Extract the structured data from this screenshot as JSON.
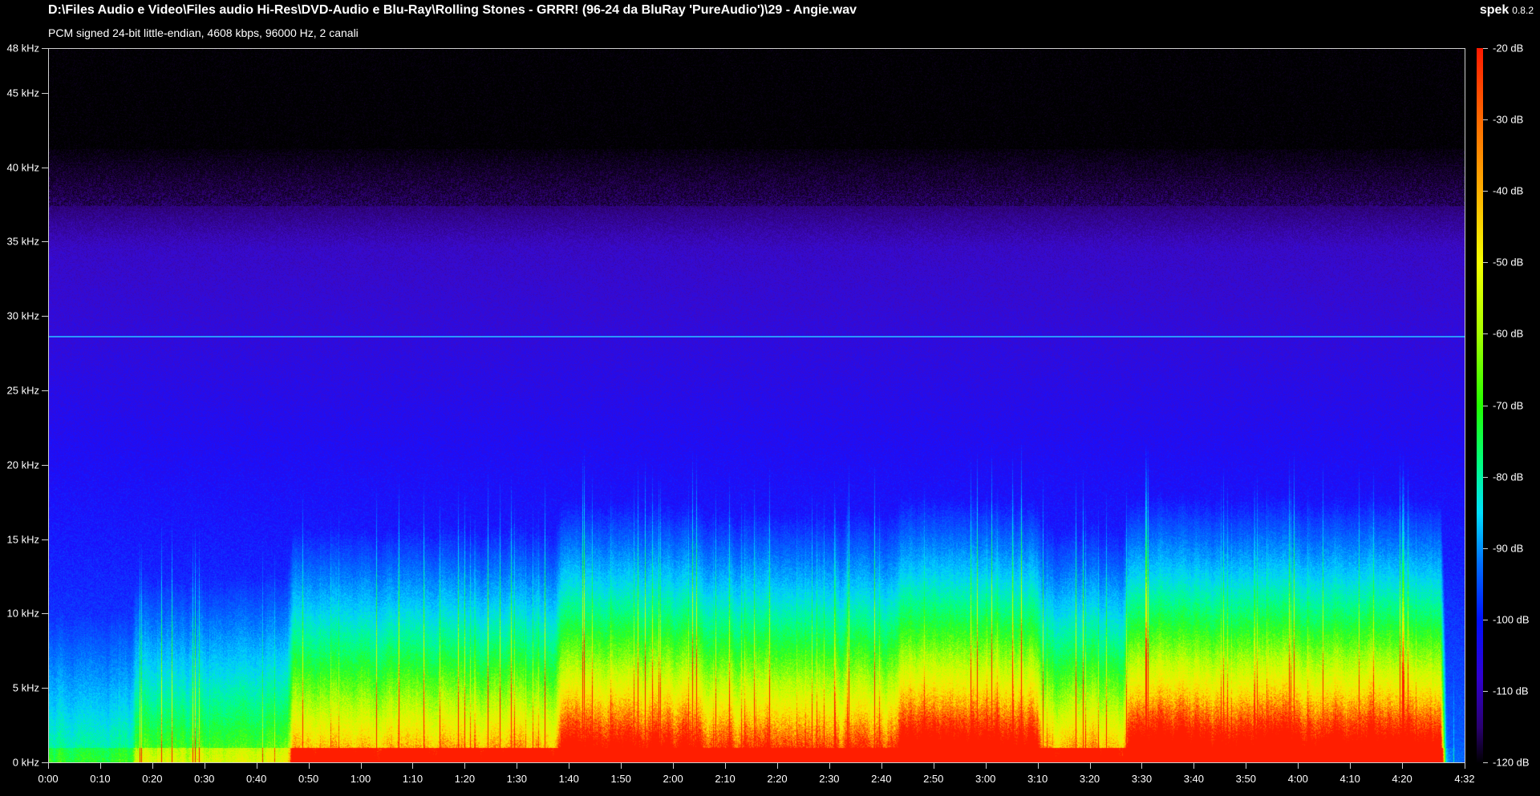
{
  "header": {
    "file_path": "D:\\Files Audio e Video\\Files audio Hi-Res\\DVD-Audio e Blu-Ray\\Rolling Stones - GRRR! (96-24 da BluRay 'PureAudio')\\29 - Angie.wav",
    "stream_info": "PCM signed 24-bit little-endian, 4608 kbps, 96000 Hz, 2 canali",
    "app_name": "spek",
    "app_version": "0.8.2"
  },
  "frequency_axis": {
    "labels": [
      "48 kHz",
      "45 kHz",
      "40 kHz",
      "35 kHz",
      "30 kHz",
      "25 kHz",
      "20 kHz",
      "15 kHz",
      "10 kHz",
      "5 kHz",
      "0 kHz"
    ],
    "values_khz": [
      48,
      45,
      40,
      35,
      30,
      25,
      20,
      15,
      10,
      5,
      0
    ]
  },
  "time_axis": {
    "labels": [
      "0:00",
      "0:10",
      "0:20",
      "0:30",
      "0:40",
      "0:50",
      "1:00",
      "1:10",
      "1:20",
      "1:30",
      "1:40",
      "1:50",
      "2:00",
      "2:10",
      "2:20",
      "2:30",
      "2:40",
      "2:50",
      "3:00",
      "3:10",
      "3:20",
      "3:30",
      "3:40",
      "3:50",
      "4:00",
      "4:10",
      "4:20",
      "4:32"
    ],
    "values_s": [
      0,
      10,
      20,
      30,
      40,
      50,
      60,
      70,
      80,
      90,
      100,
      110,
      120,
      130,
      140,
      150,
      160,
      170,
      180,
      190,
      200,
      210,
      220,
      230,
      240,
      250,
      260,
      272
    ],
    "duration_s": 272
  },
  "colorbar": {
    "labels": [
      "-20 dB",
      "-30 dB",
      "-40 dB",
      "-50 dB",
      "-60 dB",
      "-70 dB",
      "-80 dB",
      "-90 dB",
      "-100 dB",
      "-110 dB",
      "-120 dB"
    ],
    "values_db": [
      -20,
      -30,
      -40,
      -50,
      -60,
      -70,
      -80,
      -90,
      -100,
      -110,
      -120
    ]
  },
  "spectrogram": {
    "tone_line_khz": 28.7,
    "colors": {
      "background": "#000000",
      "violet": "#3a0aa8",
      "blue": "#1a10ff",
      "cyan": "#00d0ff",
      "green": "#20ff20",
      "yellow": "#ffff00",
      "red": "#ff2a00",
      "tone_line": "#2aa6ff"
    }
  }
}
